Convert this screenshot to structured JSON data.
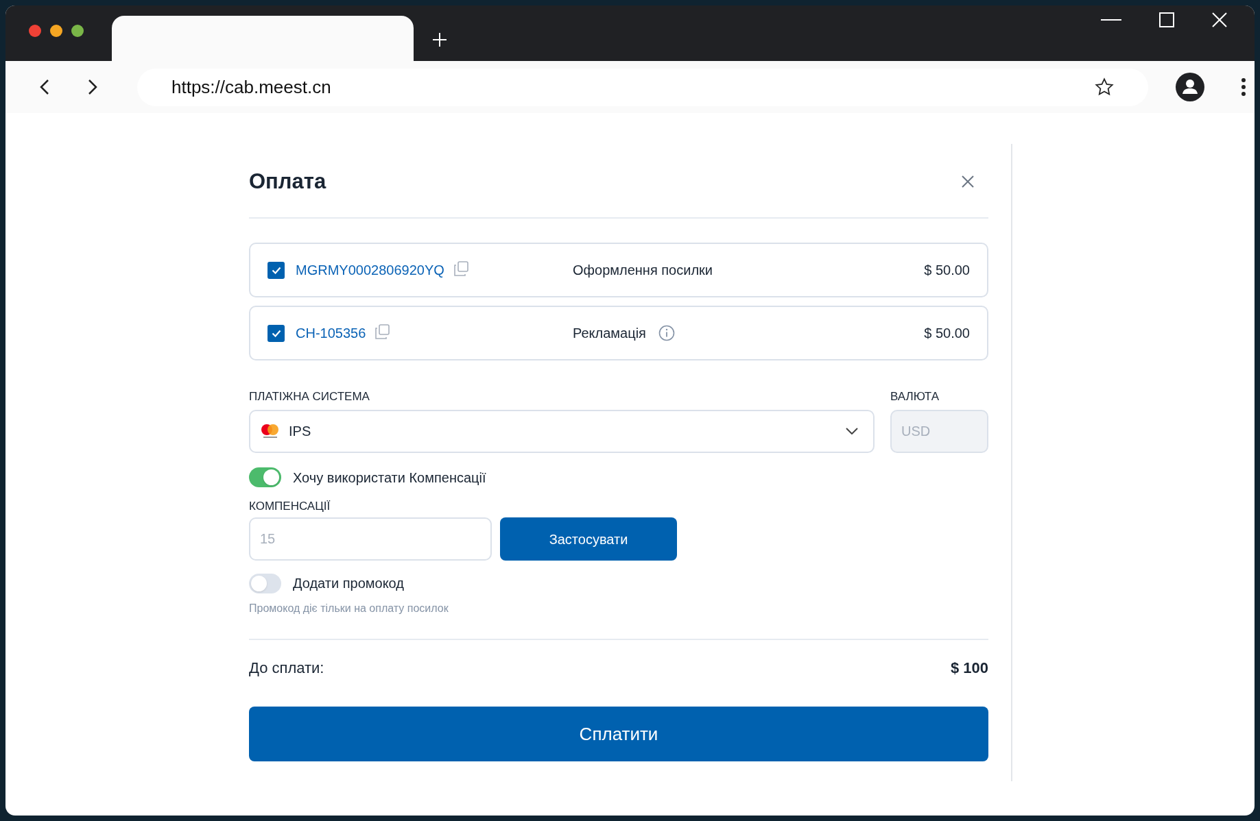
{
  "browser": {
    "url": "https://cab.meest.cn"
  },
  "dialog": {
    "title": "Оплата",
    "items": [
      {
        "checked": true,
        "code": "MGRMY0002806920YQ",
        "description": "Оформлення посилки",
        "info": false,
        "amount": "$ 50.00"
      },
      {
        "checked": true,
        "code": "CH-105356",
        "description": "Рекламація",
        "info": true,
        "amount": "$ 50.00"
      }
    ],
    "payment_system": {
      "label": "ПЛАТІЖНА СИСТЕМА",
      "value": "IPS"
    },
    "currency": {
      "label": "ВАЛЮТА",
      "placeholder": "USD",
      "disabled": true
    },
    "use_compensation": {
      "label": "Хочу використати Компенсації",
      "on": true
    },
    "compensation": {
      "label": "КОМПЕНСАЦІЇ",
      "placeholder": "15",
      "button": "Застосувати"
    },
    "promo": {
      "label": "Додати промокод",
      "on": false,
      "hint": "Промокод діє тільки на оплату посилок"
    },
    "total": {
      "label": "До сплати:",
      "value": "$ 100"
    },
    "pay_button": "Сплатити"
  }
}
